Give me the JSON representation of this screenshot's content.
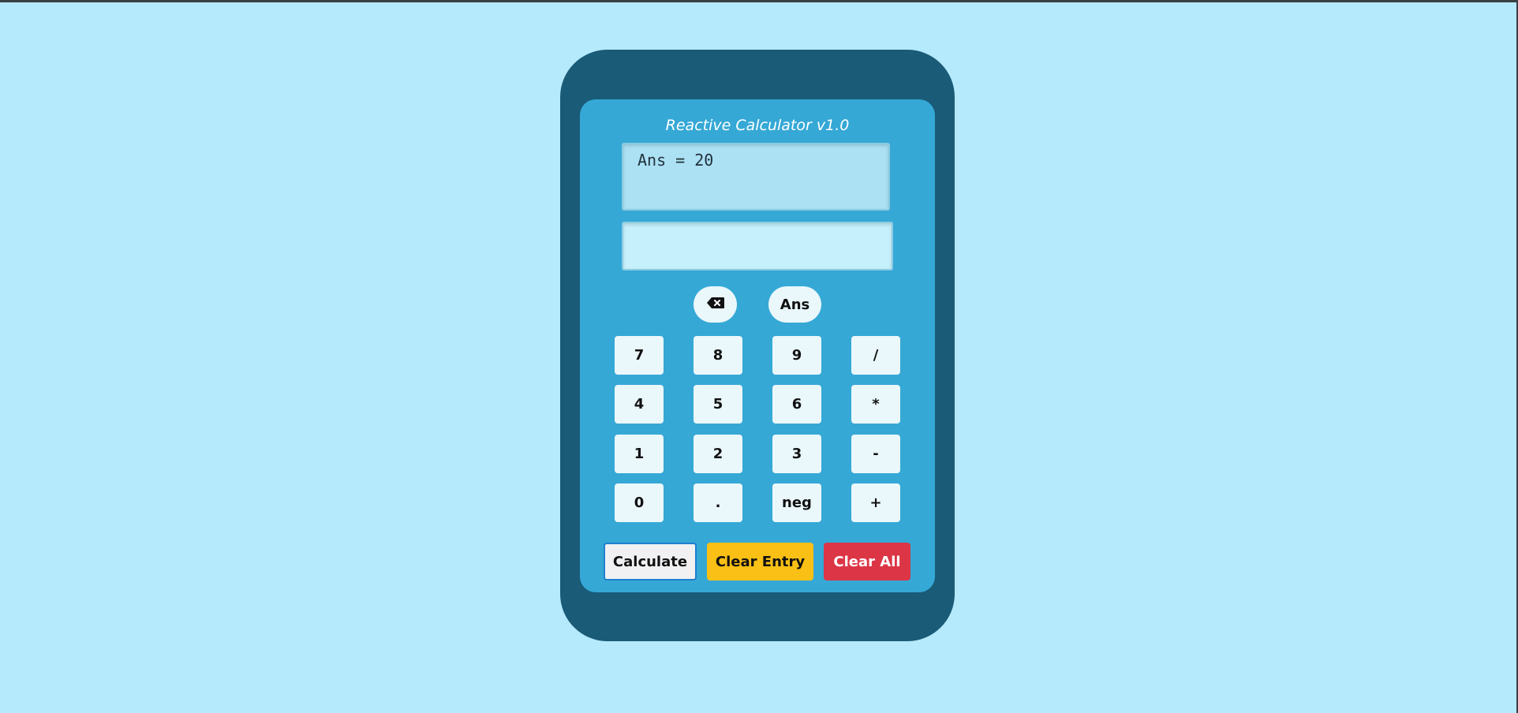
{
  "app": {
    "title": "Reactive Calculator v1.0"
  },
  "display": {
    "history": "Ans = 20",
    "input_value": "",
    "input_placeholder": ""
  },
  "function_buttons": {
    "backspace_icon": "backspace-icon",
    "ans_label": "Ans"
  },
  "keypad": {
    "rows": [
      [
        "7",
        "8",
        "9",
        "/"
      ],
      [
        "4",
        "5",
        "6",
        "*"
      ],
      [
        "1",
        "2",
        "3",
        "-"
      ],
      [
        "0",
        ".",
        "neg",
        "+"
      ]
    ]
  },
  "actions": {
    "calculate_label": "Calculate",
    "clear_entry_label": "Clear Entry",
    "clear_all_label": "Clear All"
  },
  "colors": {
    "page_bg": "#b5e9fc",
    "shell": "#1a5b77",
    "panel": "#35a8d6",
    "clear_entry": "#fbc015",
    "clear_all": "#dc3546"
  }
}
